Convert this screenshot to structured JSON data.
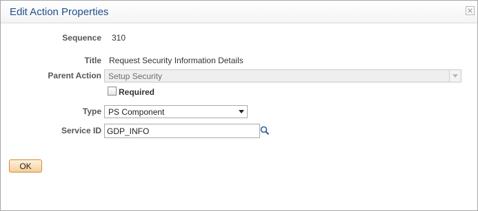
{
  "dialog": {
    "title": "Edit Action Properties",
    "close_icon": "close-icon"
  },
  "form": {
    "sequence": {
      "label": "Sequence",
      "value": "310"
    },
    "title": {
      "label": "Title",
      "value": "Request Security Information Details"
    },
    "parent_action": {
      "label": "Parent Action",
      "value": "Setup Security",
      "disabled": true
    },
    "required": {
      "label": "Required",
      "checked": false
    },
    "type": {
      "label": "Type",
      "value": "PS Component"
    },
    "service_id": {
      "label": "Service ID",
      "value": "GDP_INFO",
      "lookup_icon": "search-icon"
    }
  },
  "buttons": {
    "ok": "OK"
  },
  "colors": {
    "title": "#1f4e8c",
    "label": "#555555",
    "ok_button_gradient": [
      "#fff1dc",
      "#f6cf99"
    ],
    "ok_button_border": "#c98b3d"
  }
}
